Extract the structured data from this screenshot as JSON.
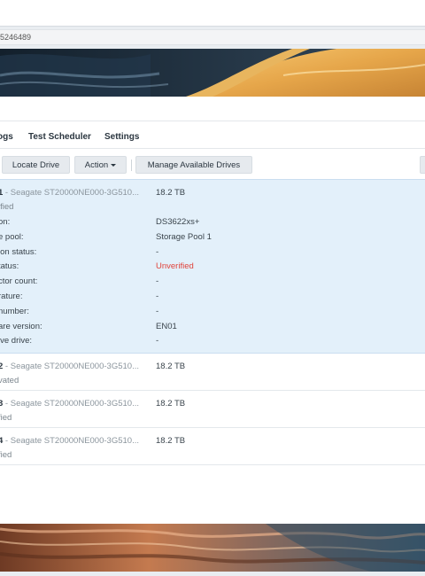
{
  "browser": {
    "url_fragment": "5246489"
  },
  "tabs": [
    {
      "label": "ogs"
    },
    {
      "label": "Test Scheduler"
    },
    {
      "label": "Settings"
    }
  ],
  "toolbar": {
    "locate_label": "Locate Drive",
    "action_label": "Action",
    "manage_label": "Manage Available Drives"
  },
  "drives": [
    {
      "num": "1",
      "model": " - Seagate ST20000NE000-3G510...",
      "size": "18.2 TB",
      "status": "ified",
      "details": [
        {
          "label": "on:",
          "value": "DS3622xs+"
        },
        {
          "label": "e pool:",
          "value": "Storage Pool 1"
        },
        {
          "label": "ion status:",
          "value": "-"
        },
        {
          "label": "tatus:",
          "value": "Unverified"
        },
        {
          "label": "ctor count:",
          "value": "-"
        },
        {
          "label": "rature:",
          "value": "-"
        },
        {
          "label": "number:",
          "value": "-"
        },
        {
          "label": "are version:",
          "value": "EN01"
        },
        {
          "label": "ive drive:",
          "value": "-"
        }
      ]
    },
    {
      "num": "2",
      "model": " - Seagate ST20000NE000-3G510...",
      "size": "18.2 TB",
      "status": "vated"
    },
    {
      "num": "3",
      "model": " - Seagate ST20000NE000-3G510...",
      "size": "18.2 TB",
      "status": "fied"
    },
    {
      "num": "4",
      "model": " - Seagate ST20000NE000-3G510...",
      "size": "18.2 TB",
      "status": "fied"
    }
  ],
  "colors": {
    "selected_row": "#e3f0fa",
    "warning_text": "#e0433b",
    "button_bg": "#e6eaee"
  }
}
